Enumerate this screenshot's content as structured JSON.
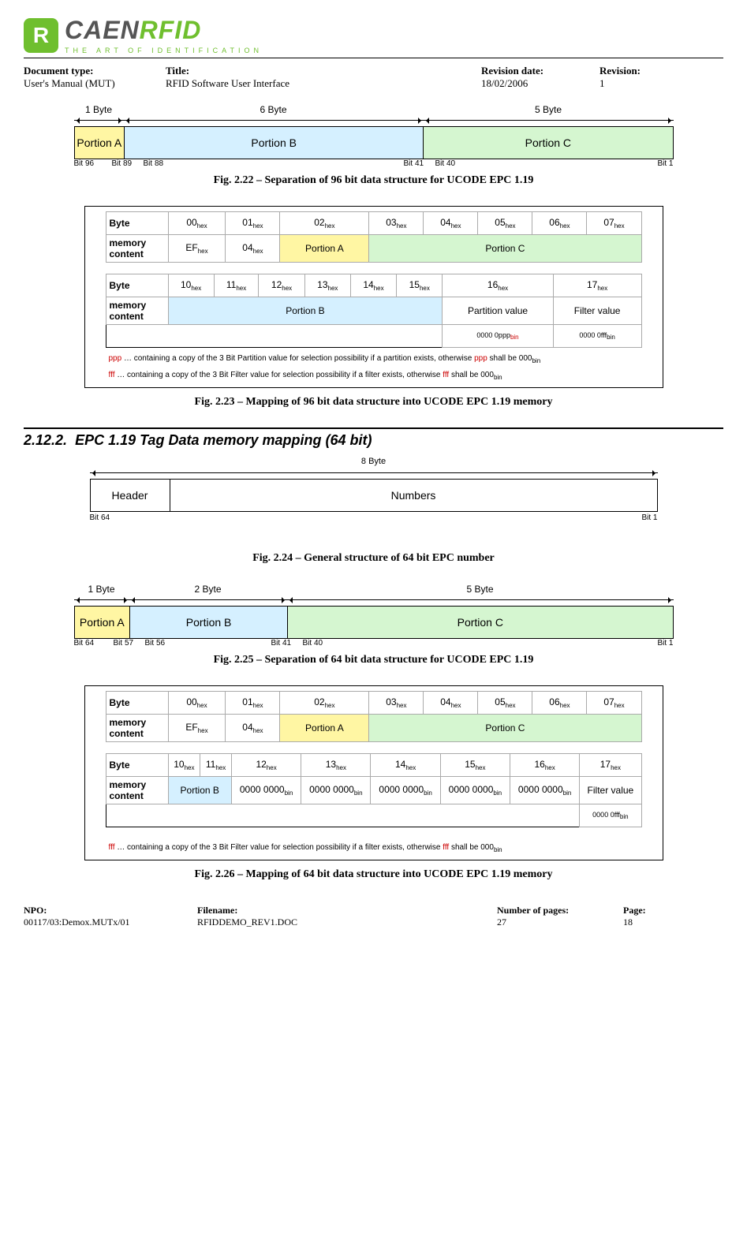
{
  "header": {
    "logo_main_1": "CAEN",
    "logo_main_2": "RFID",
    "logo_sub": "THE ART OF IDENTIFICATION",
    "doc_type_label": "Document type:",
    "doc_type_value": "User's Manual (MUT)",
    "title_label": "Title:",
    "title_value": "RFID Software User Interface",
    "rev_date_label": "Revision date:",
    "rev_date_value": "18/02/2006",
    "revision_label": "Revision:",
    "revision_value": "1"
  },
  "fig222": {
    "top_labels": [
      "1 Byte",
      "6 Byte",
      "5 Byte"
    ],
    "segs": [
      "Portion A",
      "Portion B",
      "Portion C"
    ],
    "bit_labels_left": "Bit 96",
    "bit_labels": [
      "Bit 89",
      "Bit 88",
      "Bit 41",
      "Bit 40",
      "Bit 1"
    ],
    "caption": "Fig. 2.22 – Separation of 96 bit data structure for UCODE EPC 1.19"
  },
  "fig223": {
    "tbl1_byte_label": "Byte",
    "tbl1_mem_label": "memory content",
    "tbl1_bytes": [
      "00",
      "01",
      "02",
      "03",
      "04",
      "05",
      "06",
      "07"
    ],
    "tbl1_row2": {
      "c0": "EF",
      "c1": "04",
      "pa": "Portion A",
      "pc": "Portion C"
    },
    "tbl2_bytes": [
      "10",
      "11",
      "12",
      "13",
      "14",
      "15",
      "16",
      "17"
    ],
    "tbl2_row2": {
      "pb": "Portion B",
      "partition": "Partition value",
      "filter": "Filter value"
    },
    "tbl2_sub": {
      "pv": "0000 0ppp",
      "fv": "0000 0fff"
    },
    "note1_a": "ppp",
    "note1_b": " … containing a copy of the 3 Bit Partition value for selection possibility if a partition exists, otherwise ",
    "note1_c": "ppp",
    "note1_d": " shall be 000",
    "note2_a": "fff",
    "note2_b": " … containing a copy of the 3 Bit Filter value for selection possibility if a filter exists, otherwise ",
    "note2_c": "fff",
    "note2_d": " shall be 000",
    "caption": "Fig. 2.23 – Mapping of 96 bit data structure into UCODE EPC 1.19 memory"
  },
  "section": {
    "number": "2.12.2.",
    "title": "EPC 1.19 Tag Data memory mapping (64 bit)"
  },
  "fig224": {
    "top": "8 Byte",
    "header": "Header",
    "numbers": "Numbers",
    "bit_left": "Bit 64",
    "bit_right": "Bit 1",
    "caption": "Fig. 2.24 – General structure of 64 bit EPC number"
  },
  "fig225": {
    "top_labels": [
      "1 Byte",
      "2 Byte",
      "5 Byte"
    ],
    "segs": [
      "Portion A",
      "Portion B",
      "Portion C"
    ],
    "bit_labels_left": "Bit 64",
    "bit_labels": [
      "Bit 57",
      "Bit 56",
      "Bit 41",
      "Bit 40",
      "Bit 1"
    ],
    "caption": "Fig. 2.25 – Separation of 64 bit data structure for UCODE EPC 1.19"
  },
  "fig226": {
    "tbl1_bytes": [
      "00",
      "01",
      "02",
      "03",
      "04",
      "05",
      "06",
      "07"
    ],
    "tbl1_row2": {
      "c0": "EF",
      "c1": "04",
      "pa": "Portion A",
      "pc": "Portion C"
    },
    "tbl2_bytes": [
      "10",
      "11",
      "12",
      "13",
      "14",
      "15",
      "16",
      "17"
    ],
    "tbl2_row2": {
      "pb": "Portion B",
      "zeros": "0000 0000",
      "filter": "Filter value"
    },
    "tbl2_sub_fv": "0000 0fff",
    "note_a": "fff",
    "note_b": " … containing a copy of the 3 Bit Filter value for selection possibility if a filter exists, otherwise ",
    "note_c": "fff",
    "note_d": " shall be 000",
    "caption": "Fig. 2.26 – Mapping of 64 bit data structure into UCODE EPC 1.19 memory"
  },
  "footer": {
    "npo_label": "NPO:",
    "npo_value": "00117/03:Demox.MUTx/01",
    "file_label": "Filename:",
    "file_value": "RFIDDEMO_REV1.DOC",
    "pages_label": "Number of pages:",
    "pages_value": "27",
    "page_label": "Page:",
    "page_value": "18"
  },
  "common": {
    "byte_label": "Byte",
    "mem_label": "memory content"
  }
}
